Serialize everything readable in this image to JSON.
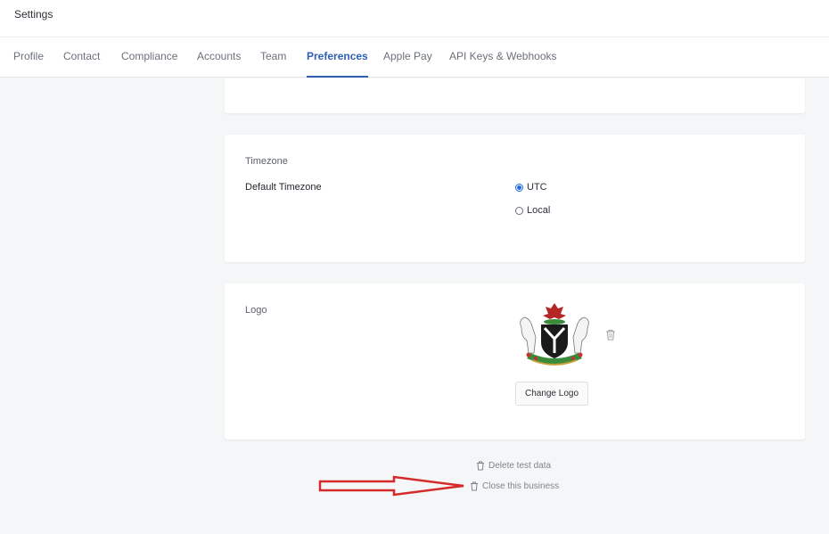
{
  "header": {
    "title": "Settings"
  },
  "tabs": [
    {
      "label": "Profile",
      "active": false
    },
    {
      "label": "Contact",
      "active": false
    },
    {
      "label": "Compliance",
      "active": false
    },
    {
      "label": "Accounts",
      "active": false
    },
    {
      "label": "Team",
      "active": false
    },
    {
      "label": "Preferences",
      "active": true
    },
    {
      "label": "Apple Pay",
      "active": false
    },
    {
      "label": "API Keys & Webhooks",
      "active": false
    }
  ],
  "timezone": {
    "section_title": "Timezone",
    "field_label": "Default Timezone",
    "options": [
      {
        "label": "UTC",
        "selected": true
      },
      {
        "label": "Local",
        "selected": false
      }
    ]
  },
  "logo": {
    "section_title": "Logo",
    "change_button": "Change Logo"
  },
  "actions": {
    "delete_test_data": "Delete test data",
    "close_business": "Close this business"
  },
  "colors": {
    "accent": "#2f5fb3",
    "radio_selected": "#1e6be6",
    "annotation_arrow": "#d62a2a"
  }
}
